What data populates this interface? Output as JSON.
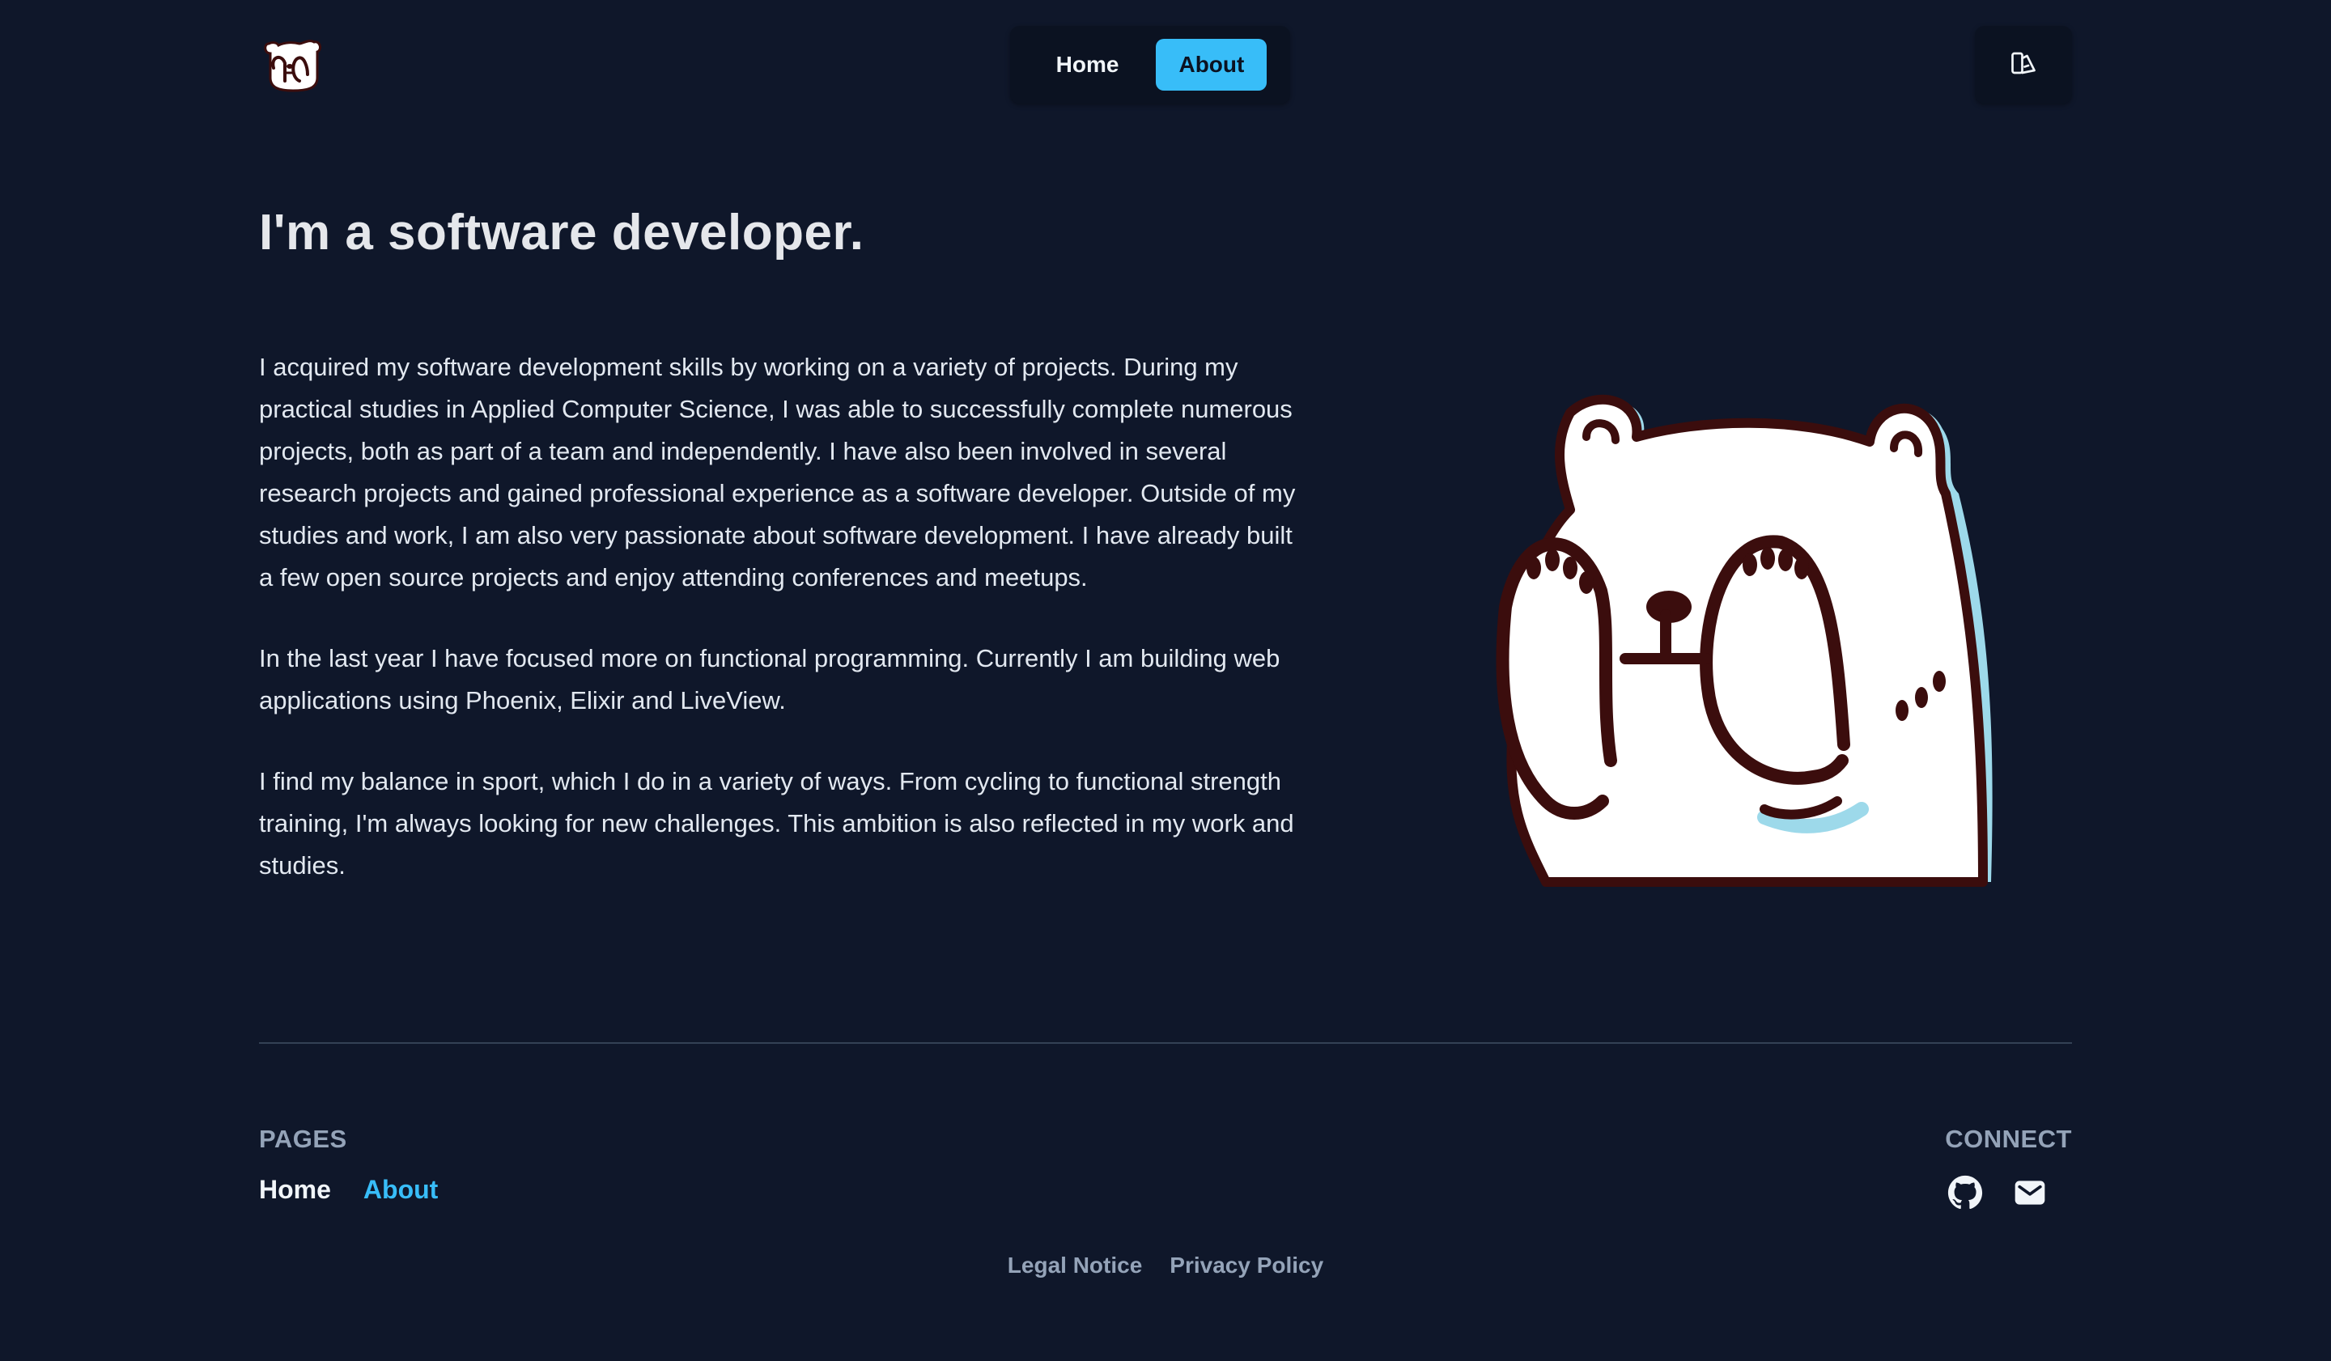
{
  "nav": {
    "items": [
      "Home",
      "About"
    ],
    "active": "About"
  },
  "header": {
    "logo_icon": "bear-logo-icon",
    "theme_icon": "theme-toggle-icon"
  },
  "main": {
    "headline": "I'm a software developer.",
    "paragraphs": [
      "I acquired my software development skills by working on a variety of projects. During my practical studies in Applied Computer Science, I was able to successfully complete numerous projects, both as part of a team and independently. I have also been involved in several research projects and gained professional experience as a software developer. Outside of my studies and work, I am also very passionate about software development. I have already built a few open source projects and enjoy attending conferences and meetups.",
      "In the last year I have focused more on functional programming. Currently I am building web applications using Phoenix, Elixir and LiveView.",
      "I find my balance in sport, which I do in a variety of ways. From cycling to functional strength training, I'm always looking for new challenges. This ambition is also reflected in my work and studies."
    ],
    "illustration": "bear-covering-face-illustration"
  },
  "footer": {
    "pages_heading": "PAGES",
    "pages": [
      "Home",
      "About"
    ],
    "connect_heading": "CONNECT",
    "social_icons": [
      "github-icon",
      "mail-icon"
    ],
    "legal": [
      "Legal Notice",
      "Privacy Policy"
    ]
  },
  "colors": {
    "background": "#0f172a",
    "accent": "#38bdf8",
    "muted": "#94a3b8",
    "text": "#e2e8f0"
  }
}
